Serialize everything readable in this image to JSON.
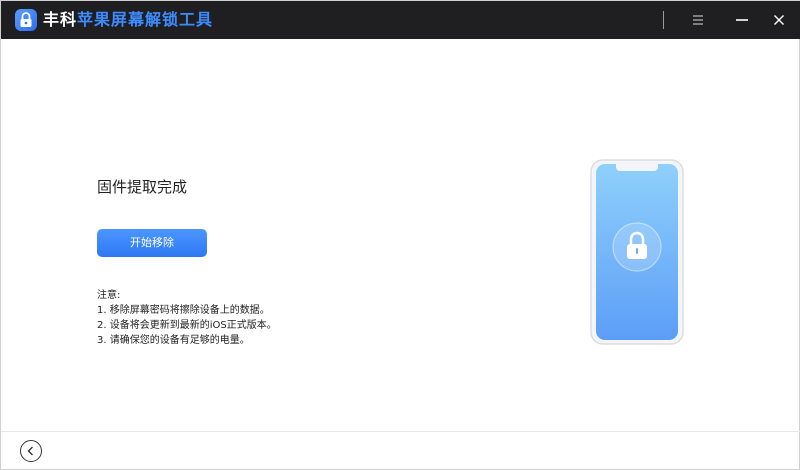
{
  "titlebar": {
    "brand": "丰科",
    "product": "苹果屏幕解锁工具",
    "menu_icon": "menu-icon",
    "minimize_icon": "minimize-icon",
    "close_icon": "close-icon"
  },
  "main": {
    "status_title": "固件提取完成",
    "start_button": "开始移除",
    "notes": {
      "heading": "注意:",
      "items": [
        "1. 移除屏幕密码将擦除设备上的数据。",
        "2. 设备将会更新到最新的iOS正式版本。",
        "3. 请确保您的设备有足够的电量。"
      ]
    }
  },
  "footer": {
    "back_icon": "back-arrow-icon"
  },
  "colors": {
    "titlebar_bg": "#1f1f22",
    "accent": "#3d8bff",
    "button": "#2d78f2"
  }
}
